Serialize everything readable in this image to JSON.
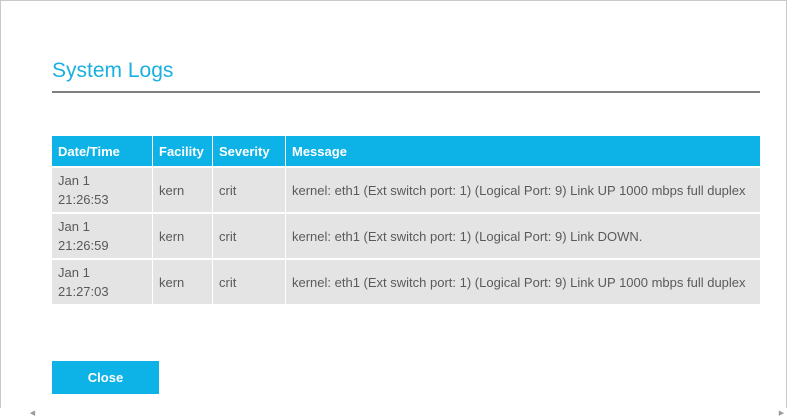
{
  "page": {
    "title": "System Logs",
    "close_label": "Close"
  },
  "table": {
    "headers": [
      "Date/Time",
      "Facility",
      "Severity",
      "Message"
    ],
    "rows": [
      {
        "date": "Jan 1",
        "time": "21:26:53",
        "facility": "kern",
        "severity": "crit",
        "message": "kernel: eth1 (Ext switch port: 1) (Logical Port: 9) Link UP 1000 mbps full duplex"
      },
      {
        "date": "Jan 1",
        "time": "21:26:59",
        "facility": "kern",
        "severity": "crit",
        "message": "kernel: eth1 (Ext switch port: 1) (Logical Port: 9) Link DOWN."
      },
      {
        "date": "Jan 1",
        "time": "21:27:03",
        "facility": "kern",
        "severity": "crit",
        "message": "kernel: eth1 (Ext switch port: 1) (Logical Port: 9) Link UP 1000 mbps full duplex"
      }
    ]
  },
  "scrollbar": {
    "left_icon": "scroll-left-arrow",
    "right_icon": "scroll-right-arrow"
  },
  "colors": {
    "accent": "#0db2e6",
    "title": "#1ab0e0",
    "row_bg": "#e4e4e4",
    "text": "#5a5a5a"
  }
}
